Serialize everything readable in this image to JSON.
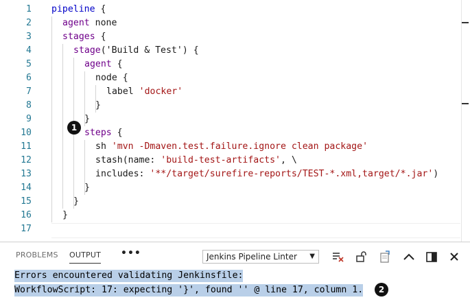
{
  "editor": {
    "lines": [
      {
        "n": "1",
        "indent": 0,
        "tokens": [
          {
            "t": "pipeline",
            "c": "kwb"
          },
          {
            "t": " {",
            "c": "plain"
          }
        ]
      },
      {
        "n": "2",
        "indent": 1,
        "tokens": [
          {
            "t": "agent",
            "c": "kw"
          },
          {
            "t": " none",
            "c": "plain"
          }
        ]
      },
      {
        "n": "3",
        "indent": 1,
        "tokens": [
          {
            "t": "stages",
            "c": "kw"
          },
          {
            "t": " {",
            "c": "plain"
          }
        ]
      },
      {
        "n": "4",
        "indent": 2,
        "tokens": [
          {
            "t": "stage",
            "c": "kw"
          },
          {
            "t": "(",
            "c": "plain"
          },
          {
            "t": "'Build & Test'",
            "c": "plain"
          },
          {
            "t": ") {",
            "c": "plain"
          }
        ]
      },
      {
        "n": "5",
        "indent": 3,
        "tokens": [
          {
            "t": "agent",
            "c": "kw"
          },
          {
            "t": " {",
            "c": "plain"
          }
        ]
      },
      {
        "n": "6",
        "indent": 4,
        "tokens": [
          {
            "t": "node",
            "c": "plain"
          },
          {
            "t": " {",
            "c": "plain"
          }
        ]
      },
      {
        "n": "7",
        "indent": 5,
        "tokens": [
          {
            "t": "label",
            "c": "plain"
          },
          {
            "t": " ",
            "c": "plain"
          },
          {
            "t": "'docker'",
            "c": "str"
          }
        ]
      },
      {
        "n": "8",
        "indent": 4,
        "tokens": [
          {
            "t": "}",
            "c": "plain"
          }
        ]
      },
      {
        "n": "9",
        "indent": 3,
        "tokens": [
          {
            "t": "}",
            "c": "plain"
          }
        ]
      },
      {
        "n": "10",
        "indent": 3,
        "tokens": [
          {
            "t": "steps",
            "c": "kw"
          },
          {
            "t": " {",
            "c": "plain"
          }
        ]
      },
      {
        "n": "11",
        "indent": 4,
        "tokens": [
          {
            "t": "sh",
            "c": "plain"
          },
          {
            "t": " ",
            "c": "plain"
          },
          {
            "t": "'mvn -Dmaven.test.failure.ignore clean package'",
            "c": "str"
          }
        ]
      },
      {
        "n": "12",
        "indent": 4,
        "tokens": [
          {
            "t": "stash(name: ",
            "c": "plain"
          },
          {
            "t": "'build-test-artifacts'",
            "c": "str"
          },
          {
            "t": ", \\",
            "c": "plain"
          }
        ]
      },
      {
        "n": "13",
        "indent": 4,
        "tokens": [
          {
            "t": "includes: ",
            "c": "plain"
          },
          {
            "t": "'**/target/surefire-reports/TEST-*.xml,target/*.jar'",
            "c": "str"
          },
          {
            "t": ")",
            "c": "plain"
          }
        ]
      },
      {
        "n": "14",
        "indent": 3,
        "tokens": [
          {
            "t": "}",
            "c": "plain"
          }
        ]
      },
      {
        "n": "15",
        "indent": 2,
        "tokens": [
          {
            "t": "}",
            "c": "plain"
          }
        ]
      },
      {
        "n": "16",
        "indent": 1,
        "tokens": [
          {
            "t": "}",
            "c": "plain"
          }
        ]
      },
      {
        "n": "17",
        "indent": 0,
        "tokens": []
      }
    ],
    "callout_1": "1"
  },
  "panel": {
    "tabs": [
      {
        "label": "PROBLEMS",
        "active": false
      },
      {
        "label": "OUTPUT",
        "active": true
      }
    ],
    "more_label": "•••",
    "channel_select": "Jenkins Pipeline Linter",
    "toolbar_icons": [
      "clear-output-icon",
      "lock-scroll-icon",
      "open-log-icon",
      "maximize-panel-icon",
      "split-panel-icon",
      "close-panel-icon"
    ],
    "output_lines": [
      "Errors encountered validating Jenkinsfile:",
      "WorkflowScript: 17: expecting '}', found '' @ line 17, column 1."
    ],
    "callout_2": "2"
  },
  "colors": {
    "line_number": "#237893",
    "keyword": "#6f008a",
    "keyword_blue": "#0000c8",
    "string": "#a31515",
    "selection": "#b9cfe8"
  }
}
